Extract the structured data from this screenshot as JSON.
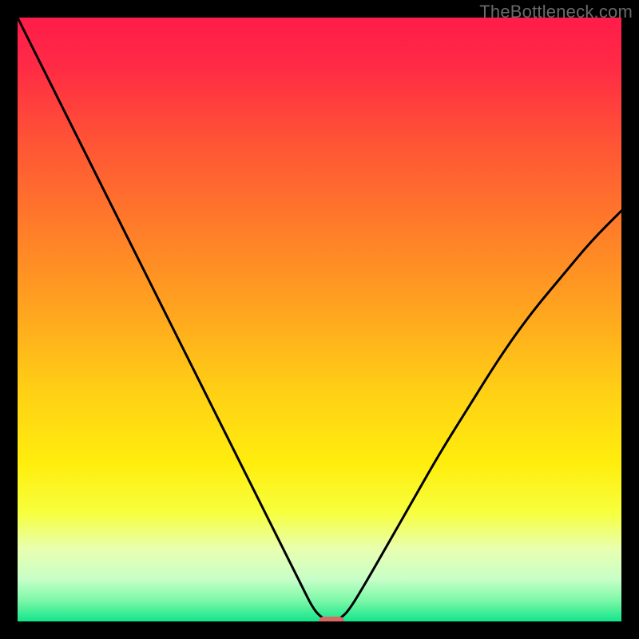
{
  "watermark": "TheBottleneck.com",
  "chart_data": {
    "type": "line",
    "title": "",
    "xlabel": "",
    "ylabel": "",
    "xlim": [
      0,
      100
    ],
    "ylim": [
      0,
      100
    ],
    "grid": false,
    "legend": false,
    "background_gradient": {
      "stops": [
        {
          "pos": 0.0,
          "color": "#ff1c4a"
        },
        {
          "pos": 0.08,
          "color": "#ff2a45"
        },
        {
          "pos": 0.2,
          "color": "#ff5236"
        },
        {
          "pos": 0.34,
          "color": "#ff7a2a"
        },
        {
          "pos": 0.48,
          "color": "#ffa31f"
        },
        {
          "pos": 0.62,
          "color": "#ffd015"
        },
        {
          "pos": 0.74,
          "color": "#ffee0d"
        },
        {
          "pos": 0.82,
          "color": "#f7ff3e"
        },
        {
          "pos": 0.88,
          "color": "#e8ffb0"
        },
        {
          "pos": 0.93,
          "color": "#c8ffc8"
        },
        {
          "pos": 0.965,
          "color": "#7df8a8"
        },
        {
          "pos": 1.0,
          "color": "#13e58b"
        }
      ]
    },
    "series": [
      {
        "name": "bottleneck-curve",
        "color": "#000000",
        "stroke_width": 3,
        "x": [
          0,
          4,
          8,
          12,
          16,
          20,
          24,
          28,
          32,
          36,
          40,
          44,
          47,
          49,
          50.5,
          52,
          53.5,
          55,
          58,
          62,
          66,
          70,
          75,
          80,
          85,
          90,
          95,
          100
        ],
        "y": [
          100,
          92,
          84,
          76,
          68,
          60,
          52,
          44,
          36,
          28,
          20,
          12,
          6,
          2,
          0.5,
          0,
          0.5,
          2,
          7,
          14,
          21,
          28,
          36,
          44,
          51,
          57,
          63,
          68
        ]
      }
    ],
    "valley_marker": {
      "x": 52,
      "y": 0,
      "color": "#d96a63"
    }
  }
}
